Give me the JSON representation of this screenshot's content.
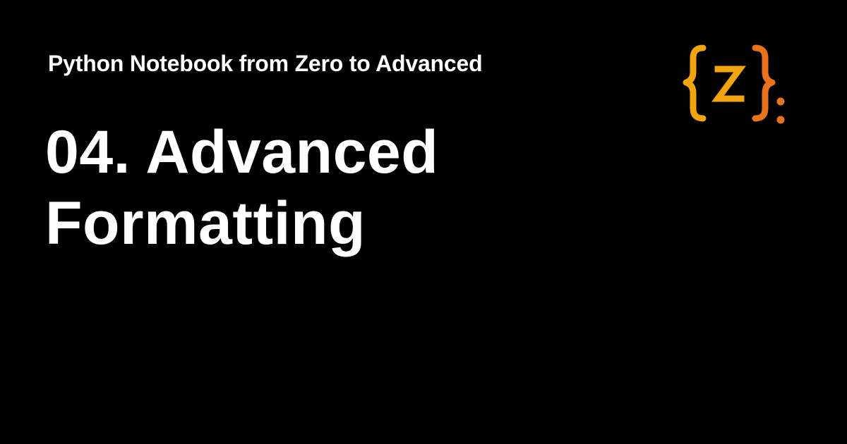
{
  "header": {
    "series_title": "Python Notebook from Zero to Advanced"
  },
  "main": {
    "title_line_1": "04. Advanced",
    "title_line_2": "Formatting"
  },
  "logo": {
    "icon": "curly-brace-z-logo",
    "text": "{z}:",
    "colors": {
      "left_brace": "#F2A40E",
      "letter": "#F2A40E",
      "right_brace": "#E8731A",
      "colon": "#E8731A"
    }
  },
  "theme": {
    "background": "#000000",
    "text": "#FFFFFF"
  }
}
